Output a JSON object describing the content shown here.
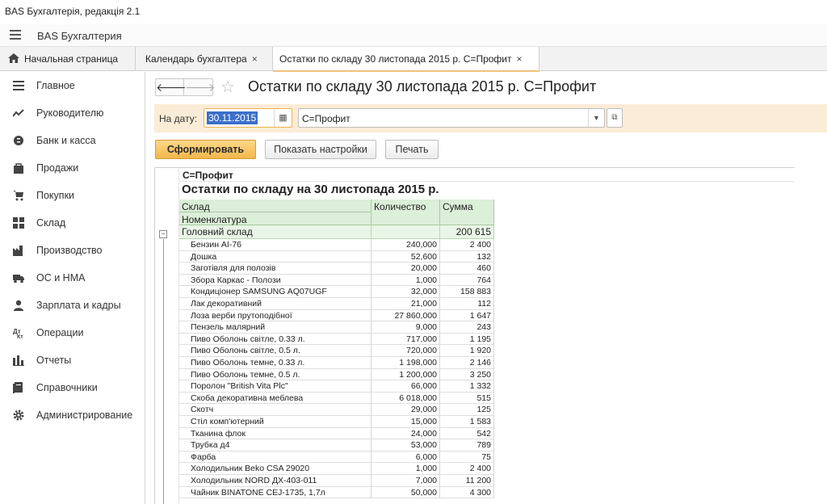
{
  "window_title": "BAS Бухгалтерія, редакція 2.1",
  "app": {
    "name": "BAS Бухгалтерия"
  },
  "tabs": {
    "home": "Начальная страница",
    "items": [
      {
        "label": "Календарь бухгалтера",
        "close": "×"
      },
      {
        "label": "Остатки по складу 30 листопада 2015 р. С=Профит",
        "close": "×"
      }
    ]
  },
  "sidebar": {
    "items": [
      {
        "label": "Главное",
        "icon": "list-icon"
      },
      {
        "label": "Руководителю",
        "icon": "trend-icon"
      },
      {
        "label": "Банк и касса",
        "icon": "coin-icon"
      },
      {
        "label": "Продажи",
        "icon": "bag-icon"
      },
      {
        "label": "Покупки",
        "icon": "cart-icon"
      },
      {
        "label": "Склад",
        "icon": "grid-icon"
      },
      {
        "label": "Производство",
        "icon": "factory-icon"
      },
      {
        "label": "ОС и НМА",
        "icon": "truck-icon"
      },
      {
        "label": "Зарплата и кадры",
        "icon": "person-icon"
      },
      {
        "label": "Операции",
        "icon": "operations-icon"
      },
      {
        "label": "Отчеты",
        "icon": "bar-chart-icon"
      },
      {
        "label": "Справочники",
        "icon": "book-icon"
      },
      {
        "label": "Администрирование",
        "icon": "gear-icon"
      }
    ]
  },
  "page": {
    "title": "Остатки по складу 30 листопада 2015 р. С=Профит",
    "nav_back": "🡐",
    "nav_forward": "🡒",
    "star": "☆"
  },
  "filter": {
    "date_label": "На дату:",
    "date_value": "30.11.2015",
    "org_value": "С=Профит"
  },
  "buttons": {
    "generate": "Сформировать",
    "settings": "Показать настройки",
    "print": "Печать"
  },
  "report": {
    "org": "С=Профит",
    "title": "Остатки по складу на 30 листопада 2015 р.",
    "headers": {
      "warehouse": "Склад",
      "item": "Номенклатура",
      "qty": "Количество",
      "sum": "Сумма"
    },
    "group": {
      "name": "Головний склад",
      "qty": "",
      "sum": "200 615"
    },
    "rows": [
      {
        "name": "Бензин АІ-76",
        "qty": "240,000",
        "sum": "2 400"
      },
      {
        "name": "Дошка",
        "qty": "52,600",
        "sum": "132"
      },
      {
        "name": "Заготівля для полозів",
        "qty": "20,000",
        "sum": "460"
      },
      {
        "name": "Збора Каркас - Полози",
        "qty": "1,000",
        "sum": "764"
      },
      {
        "name": "Кондиціонер SAMSUNG AQ07UGF",
        "qty": "32,000",
        "sum": "158 883"
      },
      {
        "name": "Лак декоративний",
        "qty": "21,000",
        "sum": "112"
      },
      {
        "name": "Лоза верби прутоподібної",
        "qty": "27 860,000",
        "sum": "1 647"
      },
      {
        "name": "Пензель малярний",
        "qty": "9,000",
        "sum": "243"
      },
      {
        "name": "Пиво Оболонь світле, 0.33 л.",
        "qty": "717,000",
        "sum": "1 195"
      },
      {
        "name": "Пиво Оболонь світле, 0.5 л.",
        "qty": "720,000",
        "sum": "1 920"
      },
      {
        "name": "Пиво Оболонь темне, 0.33 л.",
        "qty": "1 198,000",
        "sum": "2 146"
      },
      {
        "name": "Пиво Оболонь темне, 0.5 л.",
        "qty": "1 200,000",
        "sum": "3 250"
      },
      {
        "name": "Поролон \"British Vita Plc\"",
        "qty": "66,000",
        "sum": "1 332"
      },
      {
        "name": "Скоба декоративна меблева",
        "qty": "6 018,000",
        "sum": "515"
      },
      {
        "name": "Скотч",
        "qty": "29,000",
        "sum": "125"
      },
      {
        "name": "Стіл комп'ютерний",
        "qty": "15,000",
        "sum": "1 583"
      },
      {
        "name": "Тканина флок",
        "qty": "24,000",
        "sum": "542"
      },
      {
        "name": "Трубка д4",
        "qty": "53,000",
        "sum": "789"
      },
      {
        "name": "Фарба",
        "qty": "6,000",
        "sum": "75"
      },
      {
        "name": "Холодильник Beko CSA 29020",
        "qty": "1,000",
        "sum": "2 400"
      },
      {
        "name": "Холодильник NORD ДХ-403-011",
        "qty": "7,000",
        "sum": "11 200"
      },
      {
        "name": "Чайник BINATONE CEJ-1735, 1,7л",
        "qty": "50,000",
        "sum": "4 300"
      }
    ]
  }
}
